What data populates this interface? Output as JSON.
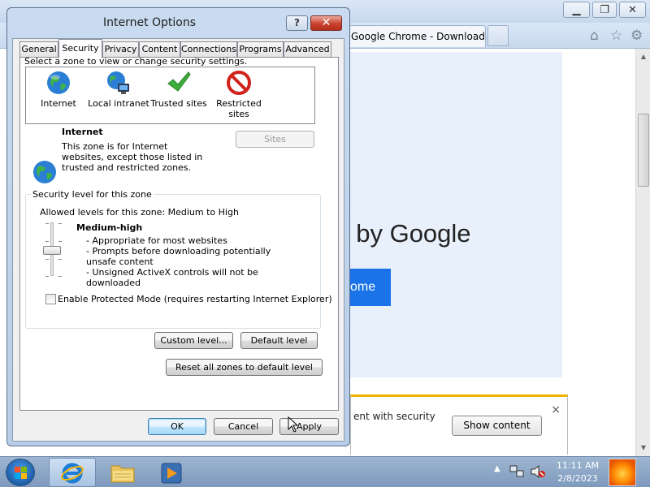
{
  "browser": {
    "tab_title": "Google Chrome - Download ...",
    "page_heading": "t by Google",
    "page_cta_label": "ome",
    "infobar": {
      "text": "ent with security",
      "show_content_label": "Show content",
      "close_glyph": "×"
    },
    "window_controls": {
      "minimize": "▁",
      "restore": "❐",
      "close": "✕"
    },
    "toolbar_icons": [
      "home-icon",
      "favorites-star-icon",
      "tools-gear-icon"
    ]
  },
  "dialog": {
    "title": "Internet Options",
    "help_glyph": "?",
    "close_glyph": "✕",
    "tabs": [
      "General",
      "Security",
      "Privacy",
      "Content",
      "Connections",
      "Programs",
      "Advanced"
    ],
    "active_tab": "Security",
    "zone_instruction": "Select a zone to view or change security settings.",
    "zones": [
      {
        "label": "Internet",
        "icon": "globe-icon"
      },
      {
        "label": "Local intranet",
        "icon": "intranet-globe-icon"
      },
      {
        "label": "Trusted sites",
        "icon": "checkmark-icon"
      },
      {
        "label": "Restricted sites",
        "icon": "restricted-icon"
      }
    ],
    "zone_info": {
      "title": "Internet",
      "description": "This zone is for Internet websites, except those listed in trusted and restricted zones."
    },
    "sites_button": "Sites",
    "security_group_label": "Security level for this zone",
    "allowed_levels": "Allowed levels for this zone: Medium to High",
    "slider_level": "Medium-high",
    "level_description": [
      "- Appropriate for most websites",
      "- Prompts before downloading potentially unsafe content",
      "- Unsigned ActiveX controls will not be downloaded"
    ],
    "protected_mode_label": "Enable Protected Mode (requires restarting Internet Explorer)",
    "protected_mode_checked": false,
    "custom_level_button": "Custom level...",
    "default_level_button": "Default level",
    "reset_all_button": "Reset all zones to default level",
    "ok_button": "OK",
    "cancel_button": "Cancel",
    "apply_button": "Apply"
  },
  "taskbar": {
    "pinned": [
      "internet-explorer-icon",
      "file-explorer-icon",
      "media-player-icon"
    ],
    "time": "11:11 AM",
    "date": "2/8/2023",
    "tray_icons": [
      "show-hidden-icons-arrow",
      "network-icon",
      "volume-muted-icon"
    ]
  },
  "colors": {
    "accent_blue": "#1a73e8",
    "infobar_yellow": "#f0b400",
    "dialog_frame": "#c9dbf0"
  }
}
